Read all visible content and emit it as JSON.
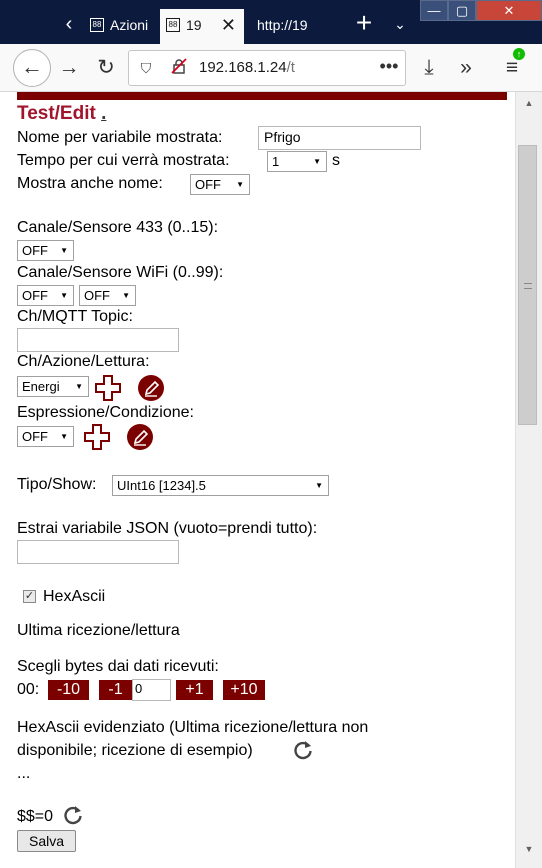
{
  "browser": {
    "tabs": [
      {
        "title": "Azioni"
      },
      {
        "title": "19"
      },
      {
        "title": "http://19"
      }
    ],
    "url_host": "192.168.1.24",
    "url_path": "/t"
  },
  "page": {
    "title": "Test/Edit",
    "title_link": ".",
    "display_name_label": "Nome per variabile mostrata:",
    "display_name_value": "Pfrigo",
    "time_label": "Tempo per cui verrà mostrata:",
    "time_value": "1",
    "time_unit": "s",
    "show_name_label": "Mostra anche nome:",
    "show_name_value": "OFF",
    "channel433_label": "Canale/Sensore 433 (0..15):",
    "channel433_value": "OFF",
    "wifi_label": "Canale/Sensore WiFi (0..99):",
    "wifi_value1": "OFF",
    "wifi_value2": "OFF",
    "mqtt_label": "Ch/MQTT Topic:",
    "mqtt_value": "",
    "action_label": "Ch/Azione/Lettura:",
    "action_value": "Energi",
    "expression_label": "Espressione/Condizione:",
    "expression_value": "OFF",
    "type_label": "Tipo/Show:",
    "type_value": "UInt16 [1234].5",
    "json_label": "Estrai variabile JSON (vuoto=prendi tutto):",
    "json_value": "",
    "hexascii_label": "HexAscii",
    "hexascii_checked": true,
    "last_reception": "Ultima ricezione/lettura",
    "bytes_label": "Scegli bytes dai dati ricevuti:",
    "bytes_prefix": "00:",
    "btn_minus10": "-10",
    "btn_minus1": "-1",
    "bytes_value": "0",
    "btn_plus1": "+1",
    "btn_plus10": "+10",
    "highlight_line1": "HexAscii evidenziato (Ultima ricezione/lettura non",
    "highlight_line2": "disponibile; ricezione di esempio)",
    "ellipsis": "...",
    "dollar_label": "$$=0",
    "save_label": "Salva"
  },
  "colors": {
    "accent": "#7b0000",
    "title": "#a0142c"
  }
}
